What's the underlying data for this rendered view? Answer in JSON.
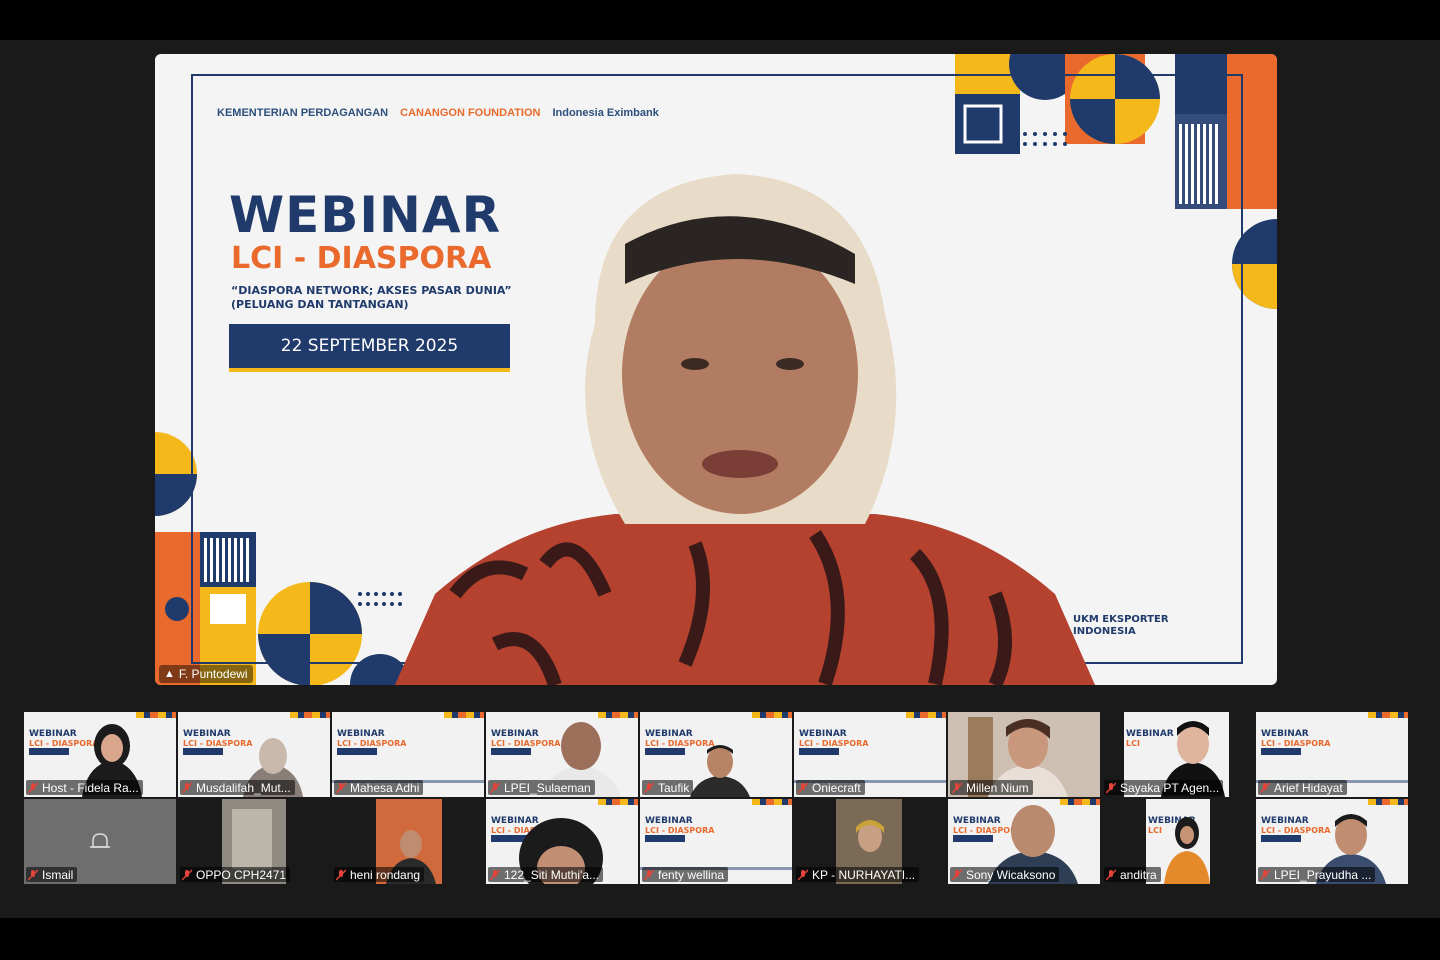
{
  "speaker": {
    "name": "F. Puntodewi",
    "slide": {
      "logos": [
        "KEMENTERIAN PERDAGANGAN",
        "CANANGON FOUNDATION",
        "Indonesia Eximbank"
      ],
      "title": "WEBINAR",
      "subtitle": "LCI - DIASPORA",
      "tagline1": "“DIASPORA NETWORK; AKSES PASAR DUNIA”",
      "tagline2": "(PELUANG DAN TANTANGAN)",
      "date": "22 SEPTEMBER 2025",
      "footer1": "UKM EKSPORTER",
      "footer2": "INDONESIA"
    }
  },
  "participants": [
    {
      "name": "Host - Fidela Ra..."
    },
    {
      "name": "Musdalifah_Mut..."
    },
    {
      "name": "Mahesa Adhi"
    },
    {
      "name": "LPEI_Sulaeman"
    },
    {
      "name": "Taufik"
    },
    {
      "name": "Oniecraft"
    },
    {
      "name": "Millen Nium"
    },
    {
      "name": "Sayaka PT Agen..."
    },
    {
      "name": "Arief Hidayat"
    },
    {
      "name": "Ismail"
    },
    {
      "name": "OPPO CPH2471"
    },
    {
      "name": "heni rondang"
    },
    {
      "name": "122_Siti Muthi'a..."
    },
    {
      "name": "fenty wellina"
    },
    {
      "name": "KP - NURHAYATI..."
    },
    {
      "name": "Sony Wicaksono"
    },
    {
      "name": "anditra"
    },
    {
      "name": "LPEI_Prayudha ..."
    }
  ],
  "colors": {
    "navy": "#1f3a6b",
    "orange": "#e96a2c",
    "yellow": "#f5b81a",
    "muted": "#e0443a"
  }
}
